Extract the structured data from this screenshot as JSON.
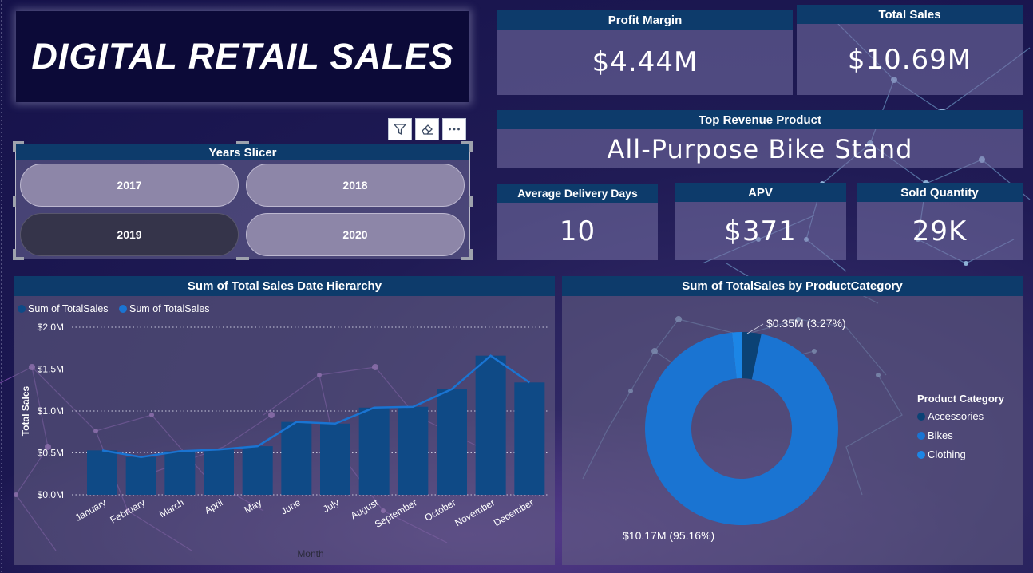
{
  "title": "DIGITAL RETAIL SALES",
  "kpis": {
    "profit_margin": {
      "label": "Profit Margin",
      "value": "$4.44M"
    },
    "total_sales": {
      "label": "Total Sales",
      "value": "$10.69M"
    },
    "top_product": {
      "label": "Top Revenue Product",
      "value": "All-Purpose Bike Stand"
    },
    "avg_delivery": {
      "label": "Average Delivery Days",
      "value": "10"
    },
    "apv": {
      "label": "APV",
      "value": "$371"
    },
    "sold_qty": {
      "label": "Sold Quantity",
      "value": "29K"
    }
  },
  "toolbar": {
    "icons": [
      "filter-icon",
      "eraser-icon",
      "more-options-icon"
    ]
  },
  "slicer": {
    "title": "Years Slicer",
    "options": [
      {
        "label": "2017",
        "selected": false
      },
      {
        "label": "2018",
        "selected": false
      },
      {
        "label": "2019",
        "selected": true
      },
      {
        "label": "2020",
        "selected": false
      }
    ]
  },
  "line_bar": {
    "title": "Sum of Total Sales Date Hierarchy",
    "legend": [
      "Sum of TotalSales",
      "Sum of TotalSales"
    ],
    "ylabel": "Total Sales",
    "xlabel": "Month",
    "y_ticks": [
      "$2.0M",
      "$1.5M",
      "$1.0M",
      "$0.5M",
      "$0.0M"
    ]
  },
  "donut": {
    "title": "Sum of TotalSales by ProductCategory",
    "legend_title": "Product Category",
    "label_small": "$0.35M (3.27%)",
    "label_large": "$10.17M (95.16%)"
  },
  "colors": {
    "header": "#0d3b6b",
    "bar": "#0f4a86",
    "line": "#1a74d2",
    "accessories": "#0b4275",
    "bikes": "#1a74d2",
    "clothing": "#1c86e6"
  },
  "chart_data": [
    {
      "type": "bar",
      "title": "Sum of Total Sales Date Hierarchy",
      "xlabel": "Month",
      "ylabel": "Total Sales",
      "categories": [
        "January",
        "February",
        "March",
        "April",
        "May",
        "June",
        "July",
        "August",
        "September",
        "October",
        "November",
        "December"
      ],
      "series": [
        {
          "name": "Sum of TotalSales",
          "kind": "bar",
          "values": [
            0.53,
            0.45,
            0.52,
            0.54,
            0.58,
            0.87,
            0.85,
            1.04,
            1.05,
            1.26,
            1.66,
            1.34
          ]
        },
        {
          "name": "Sum of TotalSales",
          "kind": "line",
          "values": [
            0.53,
            0.45,
            0.52,
            0.54,
            0.58,
            0.87,
            0.85,
            1.04,
            1.05,
            1.26,
            1.66,
            1.34
          ]
        }
      ],
      "ylim": [
        0,
        2.0
      ],
      "unit": "$M",
      "grid": true,
      "legend": "top-left"
    },
    {
      "type": "pie",
      "title": "Sum of TotalSales by ProductCategory",
      "categories": [
        "Accessories",
        "Bikes",
        "Clothing"
      ],
      "values": [
        0.35,
        10.17,
        0.17
      ],
      "percent": [
        3.27,
        95.16,
        1.57
      ],
      "unit": "$M",
      "legend": "right"
    }
  ]
}
